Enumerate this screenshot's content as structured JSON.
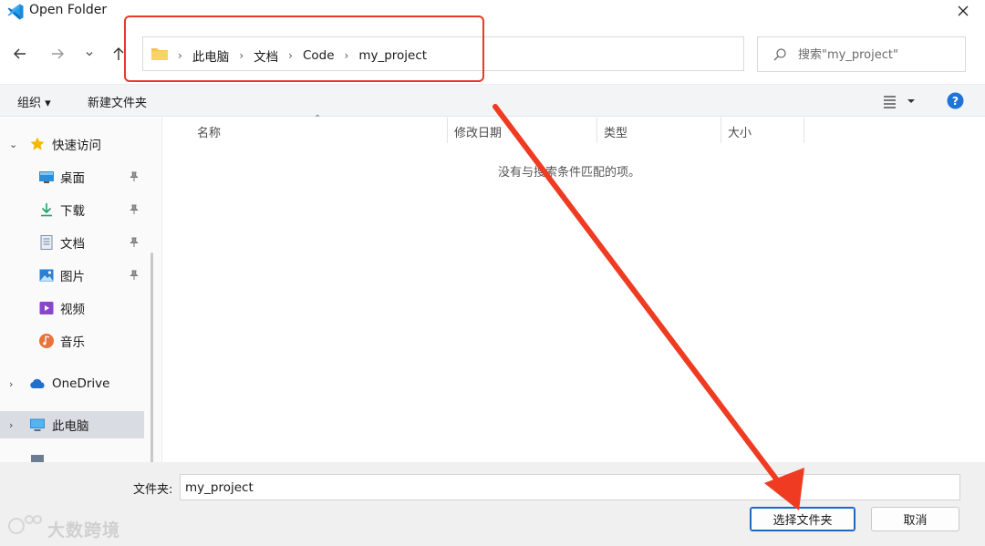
{
  "window": {
    "title": "Open Folder"
  },
  "address_bar": {
    "crumbs": [
      "此电脑",
      "文档",
      "Code",
      "my_project"
    ]
  },
  "search": {
    "placeholder": "搜索\"my_project\""
  },
  "toolbar": {
    "organize_label": "组织 ▾",
    "new_folder_label": "新建文件夹"
  },
  "sidebar": {
    "quick_access": "快速访问",
    "items": [
      {
        "label": "桌面",
        "icon": "desktop-icon",
        "pinned": true
      },
      {
        "label": "下载",
        "icon": "download-icon",
        "pinned": true
      },
      {
        "label": "文档",
        "icon": "document-icon",
        "pinned": true
      },
      {
        "label": "图片",
        "icon": "picture-icon",
        "pinned": true
      },
      {
        "label": "视频",
        "icon": "video-icon",
        "pinned": false
      },
      {
        "label": "音乐",
        "icon": "music-icon",
        "pinned": false
      }
    ],
    "onedrive": "OneDrive",
    "this_pc": "此电脑"
  },
  "columns": {
    "name": "名称",
    "modified": "修改日期",
    "type": "类型",
    "size": "大小"
  },
  "empty_message": "没有与搜索条件匹配的项。",
  "bottom": {
    "folder_label": "文件夹:",
    "folder_value": "my_project",
    "select_button": "选择文件夹",
    "cancel_button": "取消"
  },
  "watermark": "大数跨境",
  "colors": {
    "accent": "#1e68c4",
    "annotation": "#e8392b"
  }
}
